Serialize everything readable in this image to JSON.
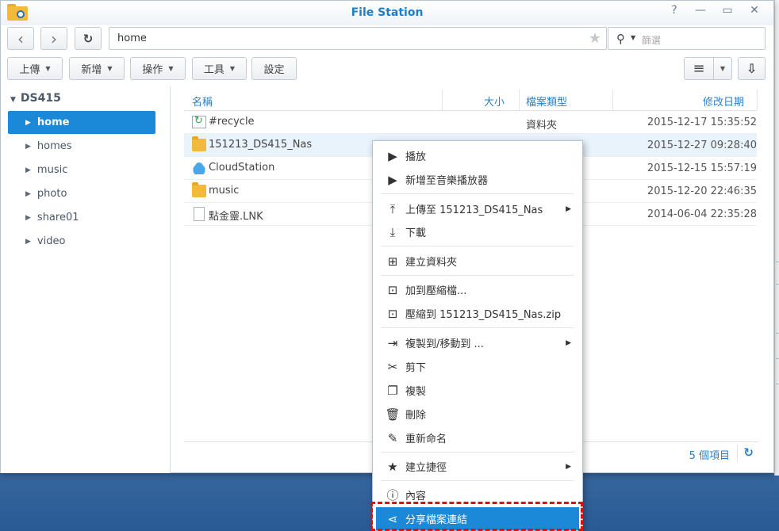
{
  "window": {
    "title": "File Station"
  },
  "window_controls": [
    {
      "name": "help",
      "glyph": "?"
    },
    {
      "name": "minimize",
      "glyph": "—"
    },
    {
      "name": "maximize",
      "glyph": "▭"
    },
    {
      "name": "close",
      "glyph": "✕"
    }
  ],
  "nav": {
    "back": "‹",
    "forward": "›",
    "refresh": "↻"
  },
  "path": {
    "value": "home",
    "star": "★"
  },
  "search": {
    "icon": "⚲",
    "placeholder": "篩選"
  },
  "toolbar": {
    "upload": "上傳",
    "create": "新增",
    "action": "操作",
    "tools": "工具",
    "settings": "設定",
    "view_list": "≡",
    "sort": "⇩"
  },
  "sidebar": {
    "root": "DS415",
    "items": [
      "home",
      "homes",
      "music",
      "photo",
      "share01",
      "video"
    ],
    "selected": "home"
  },
  "table": {
    "headers": {
      "name": "名稱",
      "size": "大小",
      "type": "檔案類型",
      "modified": "修改日期"
    },
    "rows": [
      {
        "icon": "recycle-folder-icon",
        "name": "#recycle",
        "type": "資料夾",
        "modified": "2015-12-17 15:35:52"
      },
      {
        "icon": "folder-icon",
        "name": "151213_DS415_Nas",
        "type": "",
        "modified": "2015-12-27 09:28:40"
      },
      {
        "icon": "cloud-folder-icon",
        "name": "CloudStation",
        "type": "",
        "modified": "2015-12-15 15:57:19"
      },
      {
        "icon": "folder-icon",
        "name": "music",
        "type": "",
        "modified": "2015-12-20 22:46:35"
      },
      {
        "icon": "file-icon",
        "name": "點金靈.LNK",
        "type": "",
        "modified": "2014-06-04 22:35:28"
      }
    ]
  },
  "footer": {
    "count": "5 個項目",
    "refresh": "↻"
  },
  "context_menu": {
    "items": [
      {
        "label": "播放",
        "icon": "play-icon",
        "glyph": "▶"
      },
      {
        "label": "新增至音樂播放器",
        "icon": "play-icon",
        "glyph": "▶"
      },
      {
        "label": "上傳至 151213_DS415_Nas",
        "icon": "upload-icon",
        "glyph": "⤒",
        "submenu": true
      },
      {
        "label": "下載",
        "icon": "download-icon",
        "glyph": "⤓"
      },
      {
        "label": "建立資料夾",
        "icon": "new-folder-icon",
        "glyph": "⊞"
      },
      {
        "label": "加到壓縮檔...",
        "icon": "compress-icon",
        "glyph": "⊡"
      },
      {
        "label": "壓縮到 151213_DS415_Nas.zip",
        "icon": "compress-icon",
        "glyph": "⊡"
      },
      {
        "label": "複製到/移動到 ...",
        "icon": "copy-move-icon",
        "glyph": "⇥",
        "submenu": true
      },
      {
        "label": "剪下",
        "icon": "scissors-icon",
        "glyph": "✂"
      },
      {
        "label": "複製",
        "icon": "copy-icon",
        "glyph": "❐"
      },
      {
        "label": "刪除",
        "icon": "trash-icon",
        "glyph": "🗑"
      },
      {
        "label": "重新命名",
        "icon": "pencil-icon",
        "glyph": "✎"
      },
      {
        "label": "建立捷徑",
        "icon": "star-icon",
        "glyph": "★",
        "submenu": true
      },
      {
        "label": "內容",
        "icon": "info-icon",
        "glyph": "ⓘ"
      },
      {
        "label": "分享檔案連結",
        "icon": "share-icon",
        "glyph": "⋖"
      }
    ],
    "highlighted": "分享檔案連結",
    "submenu_glyph": "▶"
  },
  "colors": {
    "accent": "#1b88d8",
    "title": "#1e7ec8",
    "annotation": "#e01010"
  }
}
